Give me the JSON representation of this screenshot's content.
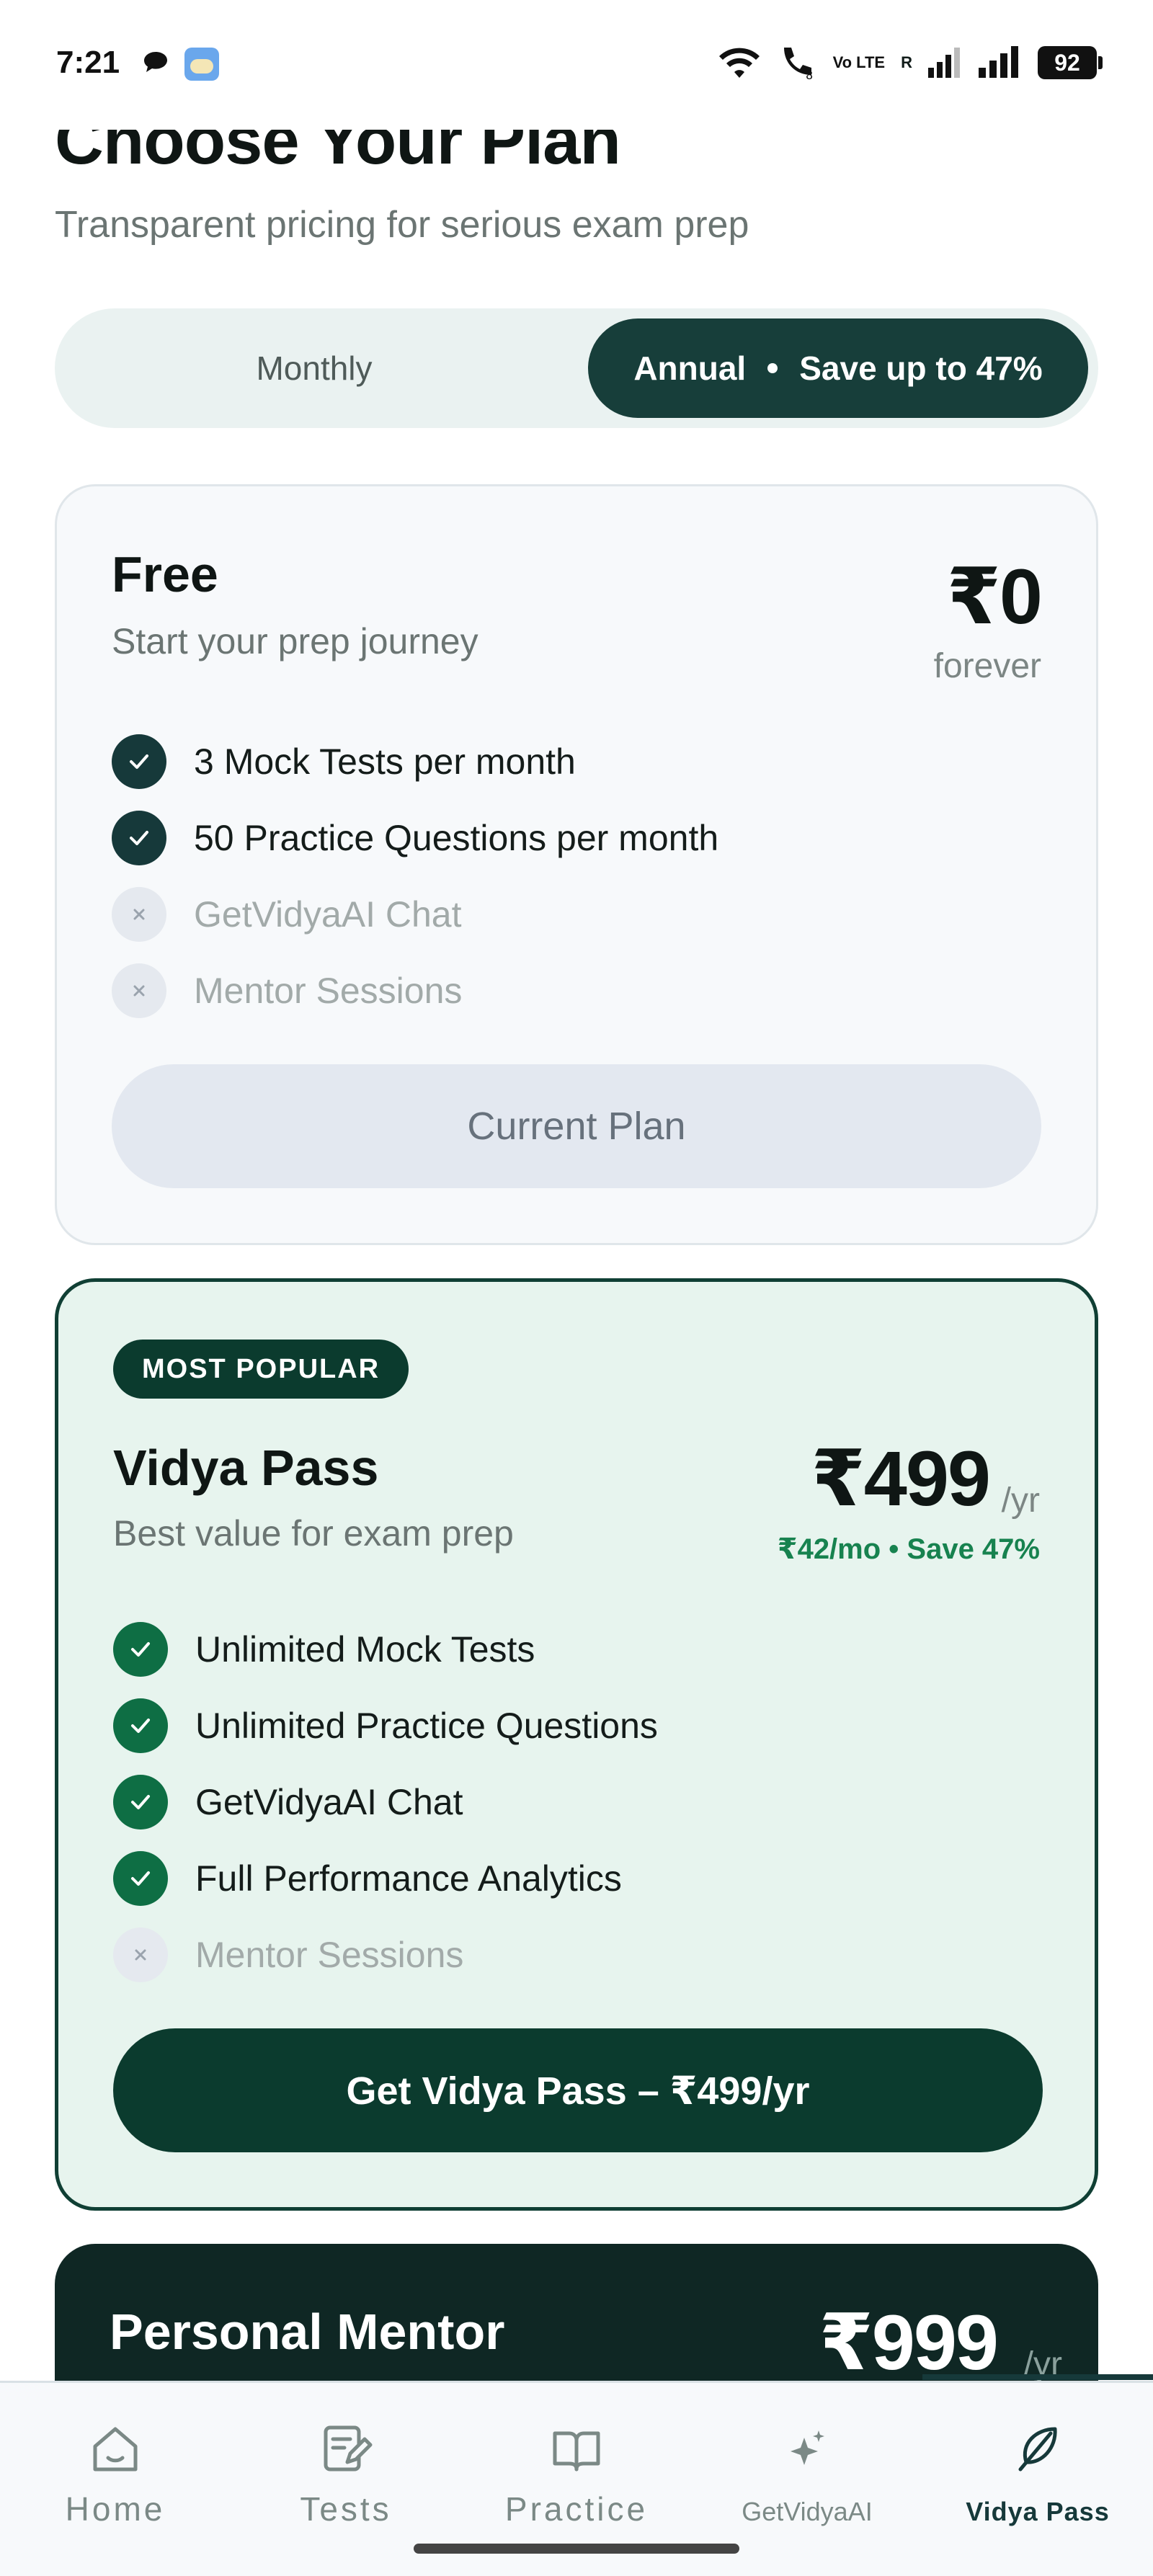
{
  "status_bar": {
    "time": "7:21",
    "network_label": "Vo LTE",
    "roaming_label": "R",
    "battery": "92"
  },
  "header": {
    "title": "Choose Your Plan",
    "subtitle": "Transparent pricing for serious exam prep"
  },
  "billing_toggle": {
    "monthly_label": "Monthly",
    "annual_label": "Annual",
    "annual_savings": "Save up to 47%",
    "selected": "Annual"
  },
  "plans": {
    "free": {
      "name": "Free",
      "description": "Start your prep journey",
      "price": "₹0",
      "period": "forever",
      "features": [
        {
          "label": "3 Mock Tests per month",
          "included": true
        },
        {
          "label": "50 Practice Questions per month",
          "included": true
        },
        {
          "label": "GetVidyaAI Chat",
          "included": false
        },
        {
          "label": "Mentor Sessions",
          "included": false
        }
      ],
      "button_label": "Current Plan"
    },
    "vidya_pass": {
      "badge": "MOST POPULAR",
      "name": "Vidya Pass",
      "description": "Best value for exam prep",
      "price": "₹499",
      "period": "/yr",
      "savings": "₹42/mo • Save 47%",
      "features": [
        {
          "label": "Unlimited Mock Tests",
          "included": true
        },
        {
          "label": "Unlimited Practice Questions",
          "included": true
        },
        {
          "label": "GetVidyaAI Chat",
          "included": true
        },
        {
          "label": "Full Performance Analytics",
          "included": true
        },
        {
          "label": "Mentor Sessions",
          "included": false
        }
      ],
      "button_label": "Get Vidya Pass  –  ₹499/yr"
    },
    "personal_mentor": {
      "name": "Personal Mentor",
      "price": "₹999",
      "period": "/yr"
    }
  },
  "bottom_nav": {
    "items": [
      {
        "label": "Home",
        "icon": "home-icon"
      },
      {
        "label": "Tests",
        "icon": "tests-icon"
      },
      {
        "label": "Practice",
        "icon": "book-icon"
      },
      {
        "label": "GetVidyaAI",
        "icon": "sparkle-icon"
      },
      {
        "label": "Vidya Pass",
        "icon": "feather-icon"
      }
    ],
    "active": "Vidya Pass"
  },
  "colors": {
    "dark_teal": "#173e3a",
    "popular_green": "#0b3b2e",
    "check_green": "#0e6e44",
    "card_mint": "#e7f4ee",
    "savings_green": "#17824f"
  }
}
